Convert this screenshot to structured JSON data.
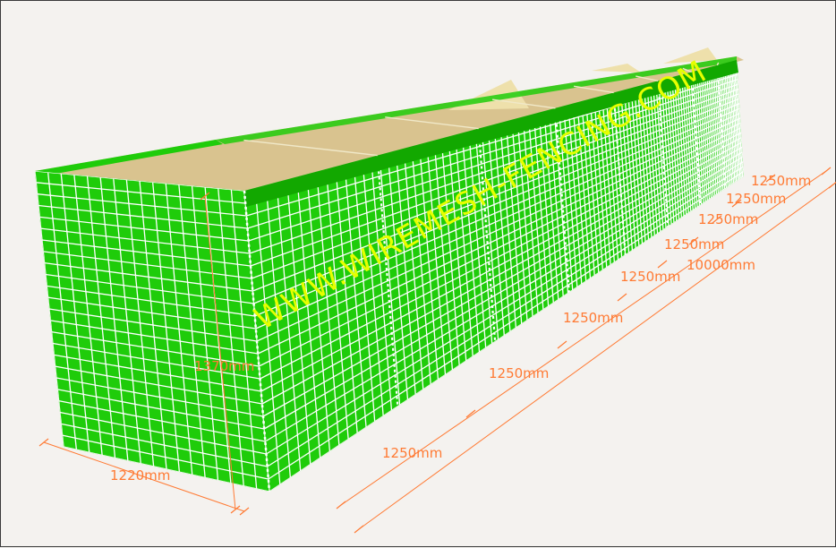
{
  "watermark": "WWW.WIREMESH-FENCING.COM",
  "colors": {
    "mesh_green": "#1fcc0a",
    "mesh_green_dark": "#12a800",
    "wire": "#ffffff",
    "fill_sand": "#d9c38f",
    "dimension": "#ff7a33",
    "watermark": "#e6ff00",
    "background": "#f4f2ef"
  },
  "dimensions": {
    "width": "1220mm",
    "height": "1370mm",
    "total_length": "10000mm",
    "segments": [
      "1250mm",
      "1250mm",
      "1250mm",
      "1250mm",
      "1250mm",
      "1250mm",
      "1250mm",
      "1250mm"
    ]
  }
}
